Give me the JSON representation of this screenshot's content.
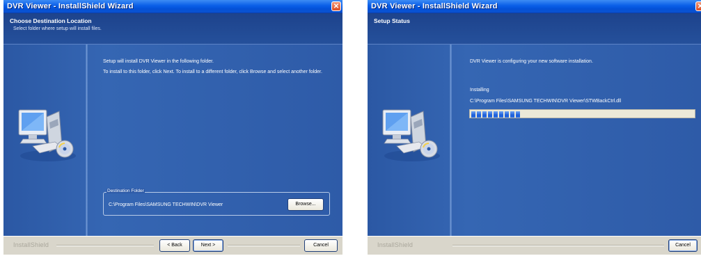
{
  "window1": {
    "title": "DVR Viewer - InstallShield Wizard",
    "header_title": "Choose Destination Location",
    "header_subtitle": "Select folder where setup will install files.",
    "message1": "Setup will install DVR Viewer in the following folder.",
    "message2": "To install to this folder, click Next. To install to a different folder, click Browse and select another folder.",
    "group_label": "Destination Folder",
    "folder_path": "C:\\Program Files\\SAMSUNG TECHWIN\\DVR Viewer",
    "browse_label": "Browse...",
    "back_label": "< Back",
    "next_label": "Next >",
    "cancel_label": "Cancel",
    "brand": "InstallShield",
    "close_glyph": "✕"
  },
  "window2": {
    "title": "DVR Viewer - InstallShield Wizard",
    "header_title": "Setup Status",
    "message": "DVR Viewer is configuring your new software installation.",
    "status_label": "Installing",
    "file_path": "C:\\Program Files\\SAMSUNG TECHWIN\\DVR Viewer\\STWBackCtrl.dll",
    "progress": 0.22,
    "progress_segments": 9,
    "cancel_label": "Cancel",
    "brand": "InstallShield",
    "close_glyph": "✕"
  },
  "icons": [
    "computer-install-icon",
    "close-icon"
  ],
  "colors": {
    "window_bg": "#2c5aa8",
    "titlebar": "#0a5fe8",
    "progress": "#2f6fe0",
    "footer": "#d9d6cb"
  }
}
